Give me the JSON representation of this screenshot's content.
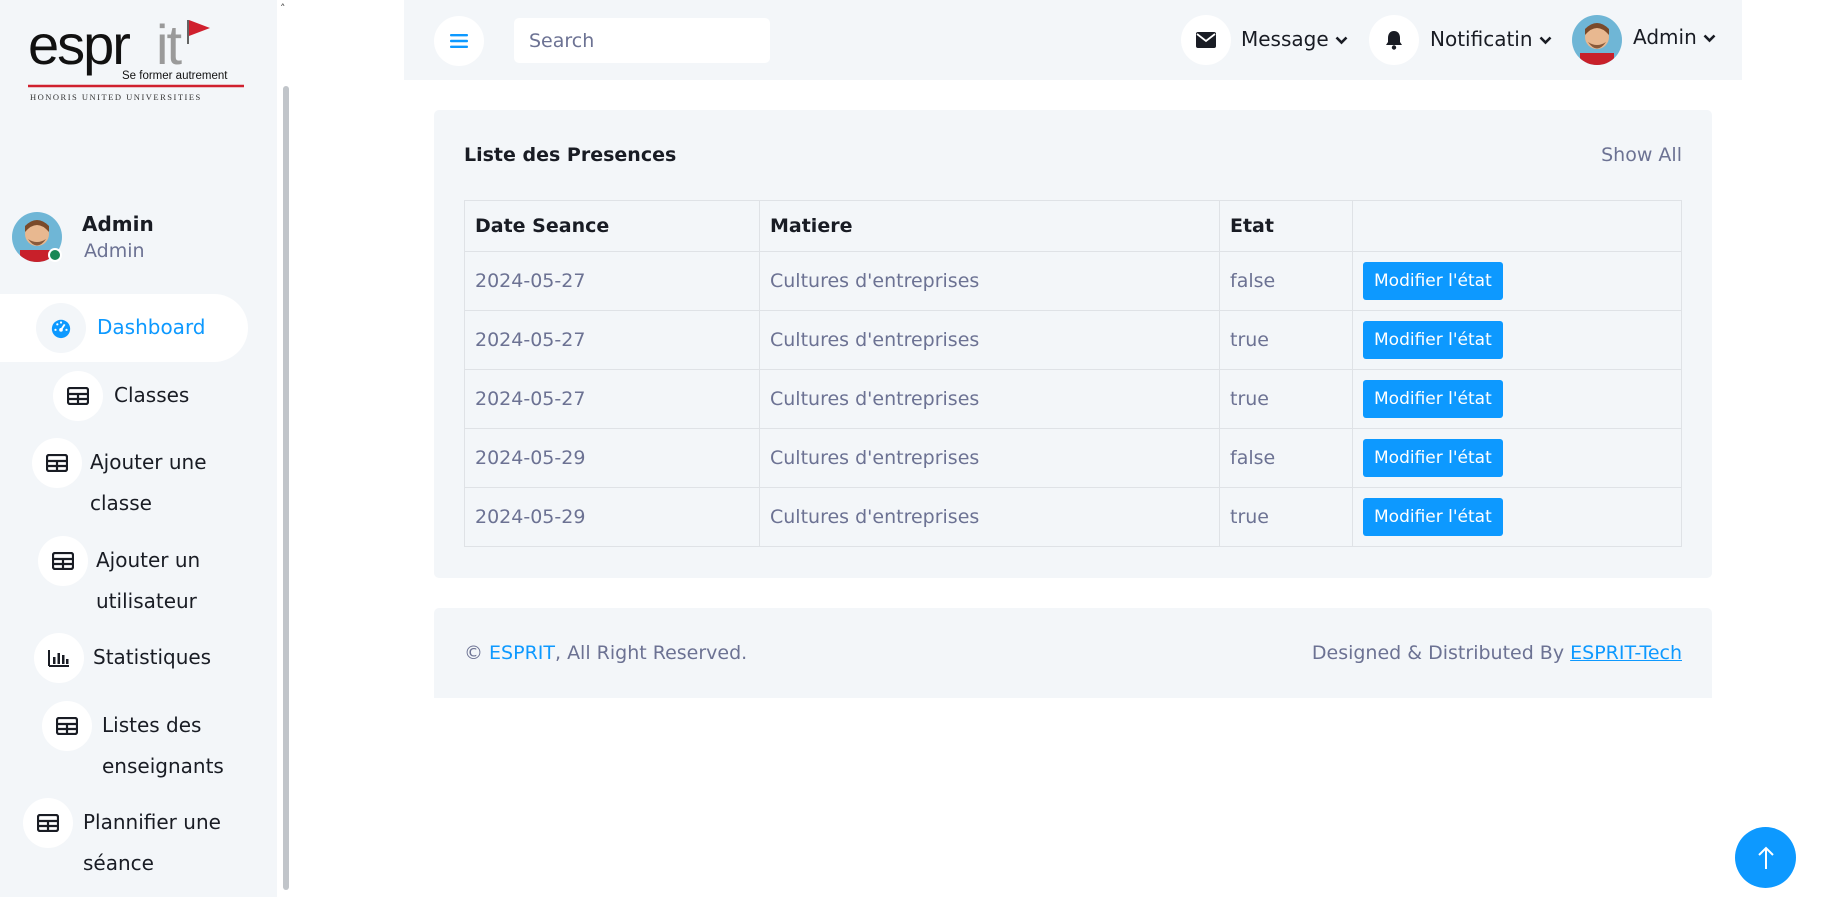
{
  "logo": {
    "wordmark": "esprit",
    "tagline": "Se former autrement",
    "subline": "HONORIS UNITED UNIVERSITIES"
  },
  "profile": {
    "name": "Admin",
    "role": "Admin"
  },
  "sidebar": {
    "items": [
      {
        "label": "Dashboard",
        "icon": "dashboard-icon",
        "active": true
      },
      {
        "label": "Classes",
        "icon": "table-icon"
      },
      {
        "label": "Ajouter une classe",
        "icon": "table-icon"
      },
      {
        "label": "Ajouter un utilisateur",
        "icon": "table-icon"
      },
      {
        "label": "Statistiques",
        "icon": "chart-icon"
      },
      {
        "label": "Listes des enseignants",
        "icon": "table-icon"
      },
      {
        "label": "Plannifier une séance",
        "icon": "table-icon"
      }
    ]
  },
  "topbar": {
    "search_placeholder": "Search",
    "message_label": "Message",
    "notification_label": "Notificatin",
    "user_label": "Admin"
  },
  "presences": {
    "title": "Liste des Presences",
    "show_all": "Show All",
    "columns": [
      "Date Seance",
      "Matiere",
      "Etat",
      ""
    ],
    "rows": [
      {
        "date": "2024-05-27",
        "matiere": "Cultures d'entreprises",
        "etat": "false",
        "action": "Modifier l'état"
      },
      {
        "date": "2024-05-27",
        "matiere": "Cultures d'entreprises",
        "etat": "true",
        "action": "Modifier l'état"
      },
      {
        "date": "2024-05-27",
        "matiere": "Cultures d'entreprises",
        "etat": "true",
        "action": "Modifier l'état"
      },
      {
        "date": "2024-05-29",
        "matiere": "Cultures d'entreprises",
        "etat": "false",
        "action": "Modifier l'état"
      },
      {
        "date": "2024-05-29",
        "matiere": "Cultures d'entreprises",
        "etat": "true",
        "action": "Modifier l'état"
      }
    ]
  },
  "footer": {
    "copyright_symbol": "©",
    "brand": "ESPRIT",
    "rights": ", All Right Reserved.",
    "designed_by": "Designed & Distributed By",
    "designer": "ESPRIT-Tech"
  },
  "colors": {
    "accent": "#0d99ff",
    "panel": "#f3f6f9",
    "text": "#191c24",
    "muted": "#6c7293",
    "logo_red": "#d0202e"
  }
}
